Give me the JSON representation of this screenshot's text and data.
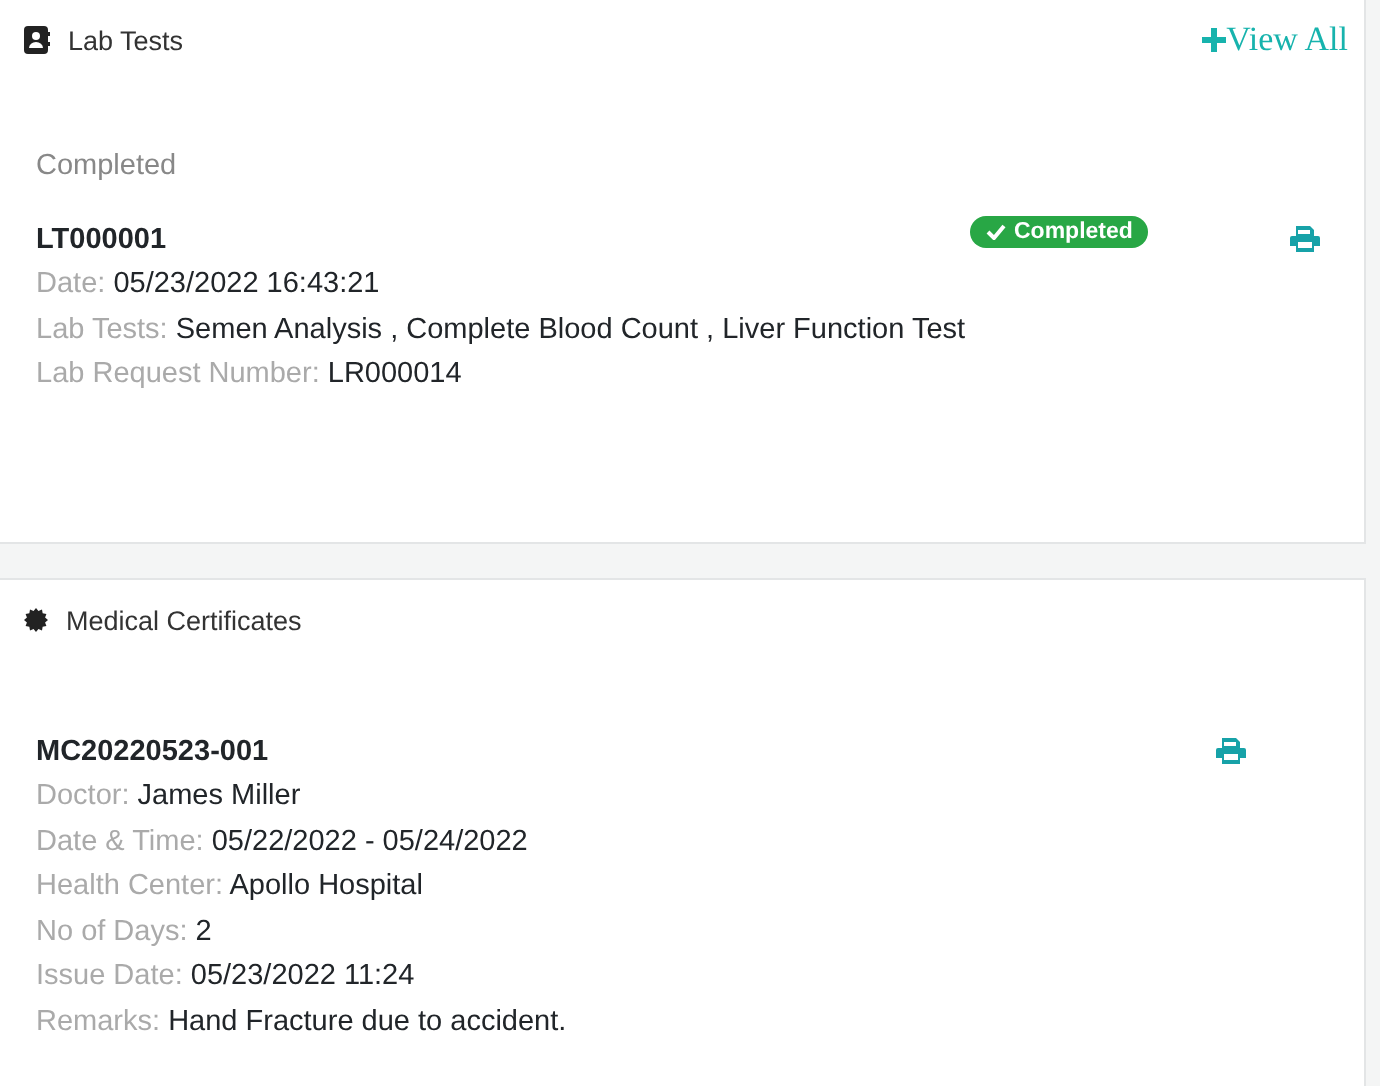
{
  "lab_tests": {
    "title": "Lab Tests",
    "view_all": "View All",
    "section_label": "Completed",
    "records": [
      {
        "id": "LT000001",
        "status": {
          "label": "Completed",
          "kind": "success"
        },
        "fields": [
          {
            "label": "Date:",
            "value": "05/23/2022 16:43:21"
          },
          {
            "label": "Lab Tests:",
            "value": "Semen Analysis , Complete Blood Count , Liver Function Test"
          },
          {
            "label": "Lab Request Number:",
            "value": "LR000014"
          }
        ]
      }
    ]
  },
  "medical_certificates": {
    "title": "Medical Certificates",
    "records": [
      {
        "id": "MC20220523-001",
        "fields": [
          {
            "label": "Doctor:",
            "value": "James Miller"
          },
          {
            "label": "Date & Time:",
            "value": "05/22/2022 - 05/24/2022"
          },
          {
            "label": "Health Center:",
            "value": "Apollo Hospital"
          },
          {
            "label": "No of Days:",
            "value": "2"
          },
          {
            "label": "Issue Date:",
            "value": "05/23/2022 11:24"
          },
          {
            "label": "Remarks:",
            "value": "Hand Fracture due to accident."
          }
        ]
      }
    ]
  }
}
